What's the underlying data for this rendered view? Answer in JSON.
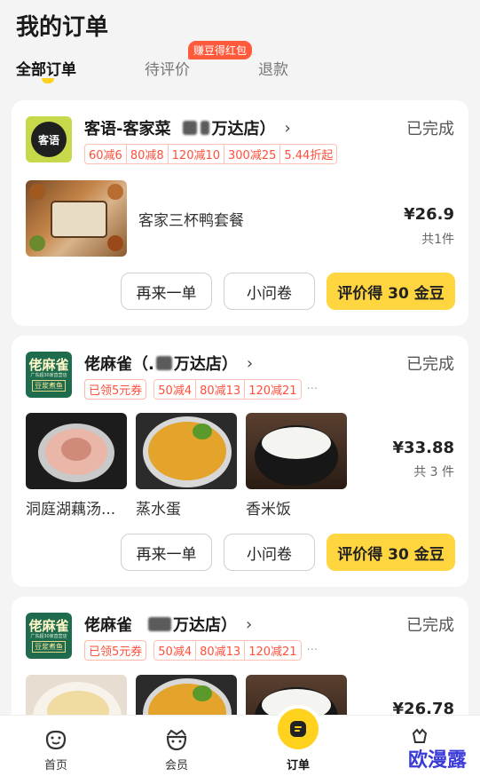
{
  "page": {
    "title": "我的订单"
  },
  "tabs": [
    {
      "label": "全部订单"
    },
    {
      "label": "待评价",
      "badge": "赚豆得红包"
    },
    {
      "label": "退款"
    }
  ],
  "orders": [
    {
      "shop_prefix": "客语-客家菜",
      "shop_suffix": "万达店）",
      "logo_text": "客语",
      "status": "已完成",
      "promos": [
        "60减6",
        "80减8",
        "120减10",
        "300减25"
      ],
      "promo_extra": "5.44折起",
      "items": [
        {
          "name": "客家三杯鸭套餐"
        }
      ],
      "price": "¥26.9",
      "qty": "共1件",
      "buttons": {
        "reorder": "再来一单",
        "survey": "小问卷",
        "review": "评价得 30 金豆"
      }
    },
    {
      "shop_prefix": "佬麻雀（.",
      "shop_suffix": "万达店）",
      "logo_text": {
        "l1": "佬麻雀",
        "l2": "广东超30家直营店",
        "l3": "豆浆煮鱼"
      },
      "status": "已完成",
      "coupon": "已领5元券",
      "promos": [
        "50减4",
        "80减13",
        "120减21"
      ],
      "promo_more": "···",
      "items": [
        {
          "name": "洞庭湖藕汤..."
        },
        {
          "name": "蒸水蛋"
        },
        {
          "name": "香米饭"
        }
      ],
      "price": "¥33.88",
      "qty": "共 3 件",
      "buttons": {
        "reorder": "再来一单",
        "survey": "小问卷",
        "review": "评价得 30 金豆"
      }
    },
    {
      "shop_prefix": "佬麻雀",
      "shop_suffix": "万达店）",
      "status": "已完成",
      "coupon": "已领5元券",
      "promos": [
        "50减4",
        "80减13",
        "120减21"
      ],
      "promo_more": "···",
      "price": "¥26.78"
    }
  ],
  "nav": [
    {
      "label": "首页"
    },
    {
      "label": "会员"
    },
    {
      "label": "订单"
    },
    {
      "label": ""
    }
  ],
  "watermark": "欧漫露"
}
